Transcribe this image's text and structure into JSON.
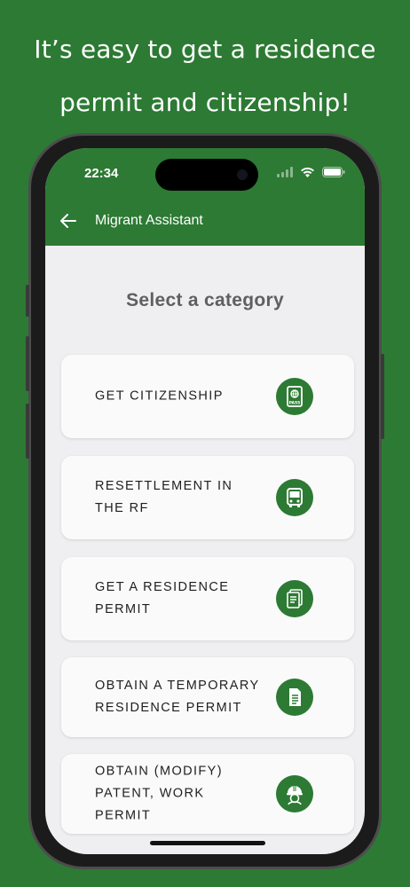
{
  "headline": {
    "line1": "It’s easy to get a residence",
    "line2": "permit and citizenship!"
  },
  "status_bar": {
    "time": "22:34",
    "icons": [
      "signal-icon",
      "wifi-icon",
      "battery-icon"
    ]
  },
  "app_bar": {
    "back_icon": "arrow-left-icon",
    "title": "Migrant Assistant"
  },
  "main": {
    "heading": "Select a category",
    "categories": [
      {
        "label": "GET CITIZENSHIP",
        "icon": "passport-icon"
      },
      {
        "label": "RESETTLEMENT IN THE RF",
        "icon": "bus-icon"
      },
      {
        "label": "GET A RESIDENCE PERMIT",
        "icon": "documents-icon"
      },
      {
        "label": "OBTAIN A TEMPORARY RESIDENCE PERMIT",
        "icon": "document-icon"
      },
      {
        "label": "OBTAIN (MODIFY) PATENT, WORK PERMIT",
        "icon": "worker-helmet-icon"
      }
    ]
  },
  "colors": {
    "brand_green": "#2c7a33",
    "background": "#efeff1",
    "card": "#fafafa"
  }
}
